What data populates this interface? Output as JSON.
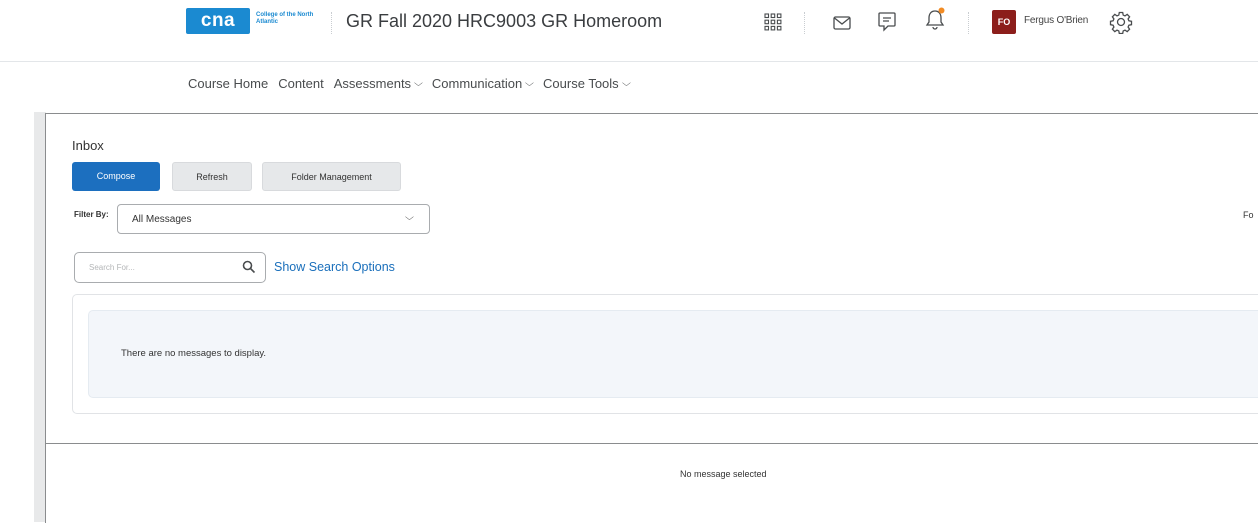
{
  "header": {
    "logo": "cna",
    "logo_subtext": "College of the North Atlantic",
    "course_title": "GR Fall 2020 HRC9003 GR Homeroom",
    "icons": [
      "grid-icon",
      "mail-icon",
      "chat-icon",
      "bell-icon",
      "gear-icon"
    ],
    "user_initials": "FO",
    "user_name": "Fergus O'Brien",
    "avatar_color": "#8c1e1b",
    "notification_color": "#f18b24"
  },
  "course_nav": {
    "items": [
      {
        "label": "Course Home",
        "dropdown": false
      },
      {
        "label": "Content",
        "dropdown": false
      },
      {
        "label": "Assessments",
        "dropdown": true
      },
      {
        "label": "Communication",
        "dropdown": true
      },
      {
        "label": "Course Tools",
        "dropdown": true
      }
    ]
  },
  "inbox": {
    "title": "Inbox",
    "buttons": {
      "compose": "Compose",
      "refresh": "Refresh",
      "folder_management": "Folder Management"
    },
    "filter_label": "Filter By:",
    "filter_value": "All Messages",
    "cut_text": "Fo",
    "search_placeholder": "Search For...",
    "search_options": "Show Search Options",
    "empty_message": "There are no messages to display.",
    "no_selection": "No message selected"
  },
  "colors": {
    "brand": "#1b8ad1",
    "primary_button": "#1c6fbf",
    "link": "#1a6fbb"
  }
}
